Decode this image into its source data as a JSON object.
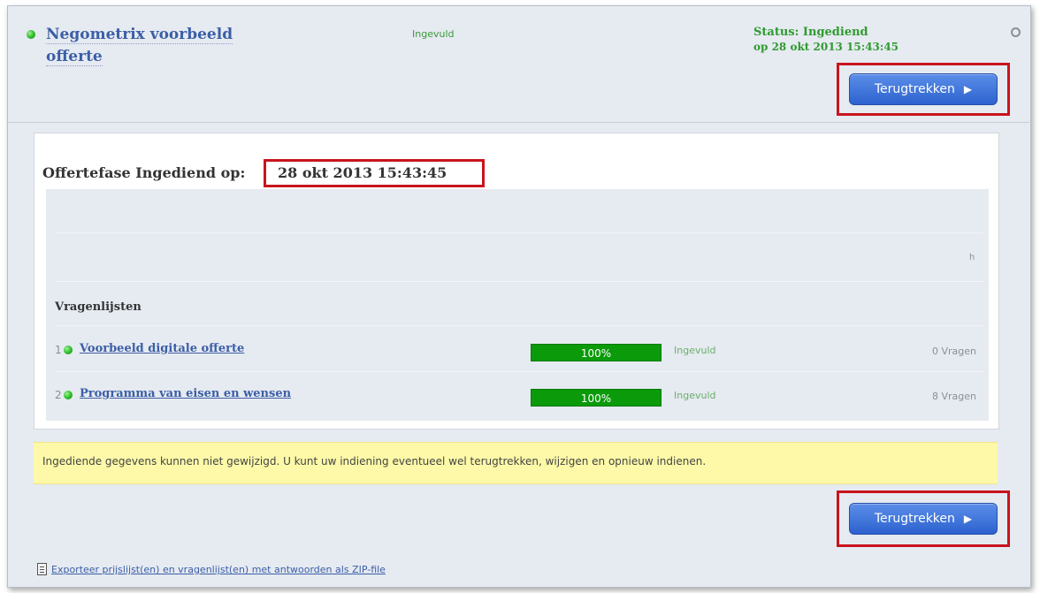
{
  "header": {
    "title": "Negometrix voorbeeld offerte",
    "fill_status": "Ingevuld",
    "status_line1": "Status: Ingediend",
    "status_line2": "op 28 okt 2013 15:43:45",
    "withdraw_button": "Terugtrekken"
  },
  "phase": {
    "label": "Offertefase Ingediend op:",
    "date": "28 okt 2013 15:43:45"
  },
  "info_row_text": "h",
  "questionnaires": {
    "title": "Vragenlijsten",
    "items": [
      {
        "number": "1",
        "name": "Voorbeeld digitale offerte",
        "progress_label": "100%",
        "progress": 1.0,
        "status": "Ingevuld",
        "count": "0 Vragen"
      },
      {
        "number": "2",
        "name": "Programma van eisen en wensen",
        "progress_label": "100%",
        "progress": 1.0,
        "status": "Ingevuld",
        "count": "8 Vragen"
      }
    ]
  },
  "notice": "Ingediende gegevens kunnen niet gewijzigd. U kunt uw indiening eventueel wel terugtrekken, wijzigen en opnieuw indienen.",
  "footer": {
    "withdraw_button": "Terugtrekken",
    "export_link": "Exporteer prijslijst(en) en vragenlijst(en) met antwoorden als ZIP-file"
  },
  "icons": {
    "status_dot": "green-dot-icon",
    "collapse": "circle-icon",
    "chevron": "chevron-right-icon",
    "export": "document-icon"
  },
  "colors": {
    "accent_blue": "#3b5fa6",
    "status_green": "#2f9b2f",
    "progress_green": "#0a9a0a",
    "highlight_red": "#c8141e",
    "notice_yellow": "#fdf9a8"
  }
}
